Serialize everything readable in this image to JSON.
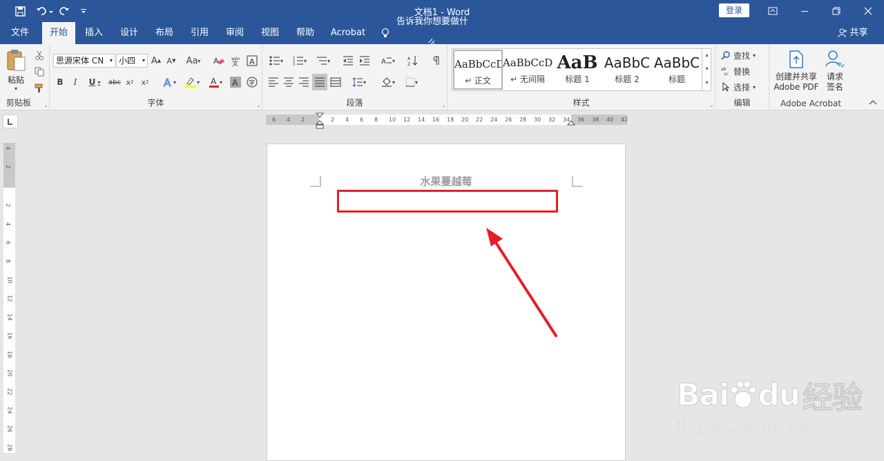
{
  "app": {
    "title": "文档1 - Word",
    "login_label": "登录"
  },
  "menu": {
    "tabs": [
      "文件",
      "开始",
      "插入",
      "设计",
      "布局",
      "引用",
      "审阅",
      "视图",
      "帮助",
      "Acrobat"
    ],
    "tell_me": "告诉我你想要做什么",
    "share": "共享"
  },
  "ribbon": {
    "clipboard": {
      "paste": "粘贴",
      "label": "剪贴板"
    },
    "font": {
      "family": "思源宋体 CN",
      "size": "小四",
      "label": "字体"
    },
    "paragraph": {
      "label": "段落"
    },
    "styles": {
      "label": "样式",
      "items": [
        {
          "preview": "AaBbCcDd",
          "name": "↵ 正文"
        },
        {
          "preview": "AaBbCcDd",
          "name": "↵ 无间隔"
        },
        {
          "preview": "AaB",
          "name": "标题 1"
        },
        {
          "preview": "AaBbC",
          "name": "标题 2"
        },
        {
          "preview": "AaBbC",
          "name": "标题"
        }
      ]
    },
    "editing": {
      "find": "查找",
      "replace": "替换",
      "select": "选择",
      "label": "编辑"
    },
    "acrobat": {
      "create_line1": "创建并共享",
      "create_line2": "Adobe PDF",
      "sign_line1": "请求",
      "sign_line2": "签名",
      "label": "Adobe Acrobat"
    }
  },
  "ruler": {
    "h_ticks": [
      "6",
      "4",
      "2",
      "2",
      "4",
      "6",
      "8",
      "10",
      "12",
      "14",
      "16",
      "18",
      "20",
      "22",
      "24",
      "26",
      "28",
      "30",
      "32",
      "34",
      "36",
      "38",
      "40",
      "42"
    ],
    "v_ticks": [
      "4",
      "2",
      "2",
      "4",
      "6",
      "8",
      "10",
      "12",
      "14",
      "16",
      "18",
      "20",
      "22",
      "24",
      "26",
      "28"
    ]
  },
  "document": {
    "header_text": "水果蔓越莓"
  },
  "watermark": {
    "brand": "Bai",
    "brand2": "du",
    "product": "经验",
    "url": "jingyan.baidu.com"
  },
  "colors": {
    "title_bar": "#2b579a",
    "highlight_box": "#e41e26",
    "ribbon_bg": "#f3f3f3"
  }
}
